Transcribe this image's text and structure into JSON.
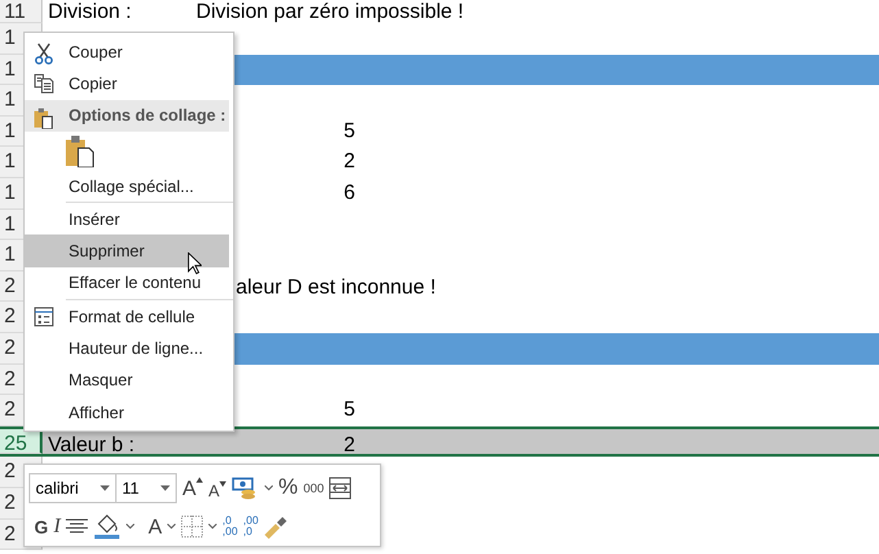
{
  "sheet": {
    "rows": [
      {
        "number": "11",
        "kind": "text",
        "selected": false,
        "column_1": "Division :",
        "column_2": "Division par zéro impossible !"
      },
      {
        "number": "1",
        "kind": "text",
        "selected": false
      },
      {
        "number": "1",
        "kind": "band",
        "selected": false
      },
      {
        "number": "1",
        "kind": "text",
        "selected": false
      },
      {
        "number": "1",
        "kind": "text",
        "selected": false,
        "column_2": "5"
      },
      {
        "number": "1",
        "kind": "text",
        "selected": false,
        "column_2": "2"
      },
      {
        "number": "1",
        "kind": "text",
        "selected": false,
        "column_2": "6"
      },
      {
        "number": "1",
        "kind": "text",
        "selected": false
      },
      {
        "number": "1",
        "kind": "text",
        "selected": false
      },
      {
        "number": "2",
        "kind": "overflow",
        "selected": false,
        "column_1": "aleur D est inconnue !"
      },
      {
        "number": "2",
        "kind": "text",
        "selected": false
      },
      {
        "number": "2",
        "kind": "band",
        "selected": false
      },
      {
        "number": "2",
        "kind": "text",
        "selected": false
      },
      {
        "number": "2",
        "kind": "text",
        "selected": false,
        "column_2": "5"
      },
      {
        "number": "25",
        "kind": "text",
        "selected": true,
        "column_1": "Valeur b :",
        "column_2": "2"
      },
      {
        "number": "2",
        "kind": "text",
        "selected": false
      },
      {
        "number": "2",
        "kind": "text",
        "selected": false
      },
      {
        "number": "2",
        "kind": "text",
        "selected": false
      }
    ]
  },
  "context_menu": {
    "items": [
      {
        "kind": "cut",
        "label": "Couper",
        "selected": false
      },
      {
        "kind": "copy",
        "label": "Copier",
        "selected": false
      },
      {
        "kind": "header",
        "label": "Options de collage :"
      },
      {
        "kind": "paste"
      },
      {
        "kind": "item",
        "label": "Collage spécial...",
        "selected": false
      },
      {
        "kind": "separator"
      },
      {
        "kind": "item",
        "label": "Insérer",
        "selected": false
      },
      {
        "kind": "item",
        "label": "Supprimer",
        "selected": true
      },
      {
        "kind": "item",
        "label": "Effacer le contenu",
        "selected": false
      },
      {
        "kind": "separator"
      },
      {
        "kind": "format",
        "label": "Format de cellule",
        "selected": false
      },
      {
        "kind": "item",
        "label": "Hauteur de ligne...",
        "selected": false
      },
      {
        "kind": "item",
        "label": "Masquer",
        "selected": false
      },
      {
        "kind": "item",
        "label": "Afficher",
        "selected": false
      }
    ]
  },
  "mini_toolbar": {
    "font_name": "calibri",
    "font_size": "11",
    "row_1": [
      {
        "kind": "grow",
        "label": "A"
      },
      {
        "kind": "shrink",
        "label": "A"
      },
      {
        "kind": "accounting"
      },
      {
        "kind": "text",
        "label": "%"
      },
      {
        "kind": "small-text",
        "label": "000"
      },
      {
        "kind": "wrap"
      }
    ],
    "row_2": [
      {
        "kind": "bold",
        "label": "G"
      },
      {
        "kind": "italic",
        "label": "I"
      },
      {
        "kind": "align"
      },
      {
        "kind": "fill"
      },
      {
        "kind": "font-color",
        "label": "A"
      },
      {
        "kind": "borders"
      },
      {
        "kind": "decimal-up",
        "lines": [
          ",0",
          ",00"
        ]
      },
      {
        "kind": "decimal-down",
        "lines": [
          ",00",
          ",0"
        ]
      },
      {
        "kind": "painter"
      }
    ]
  }
}
